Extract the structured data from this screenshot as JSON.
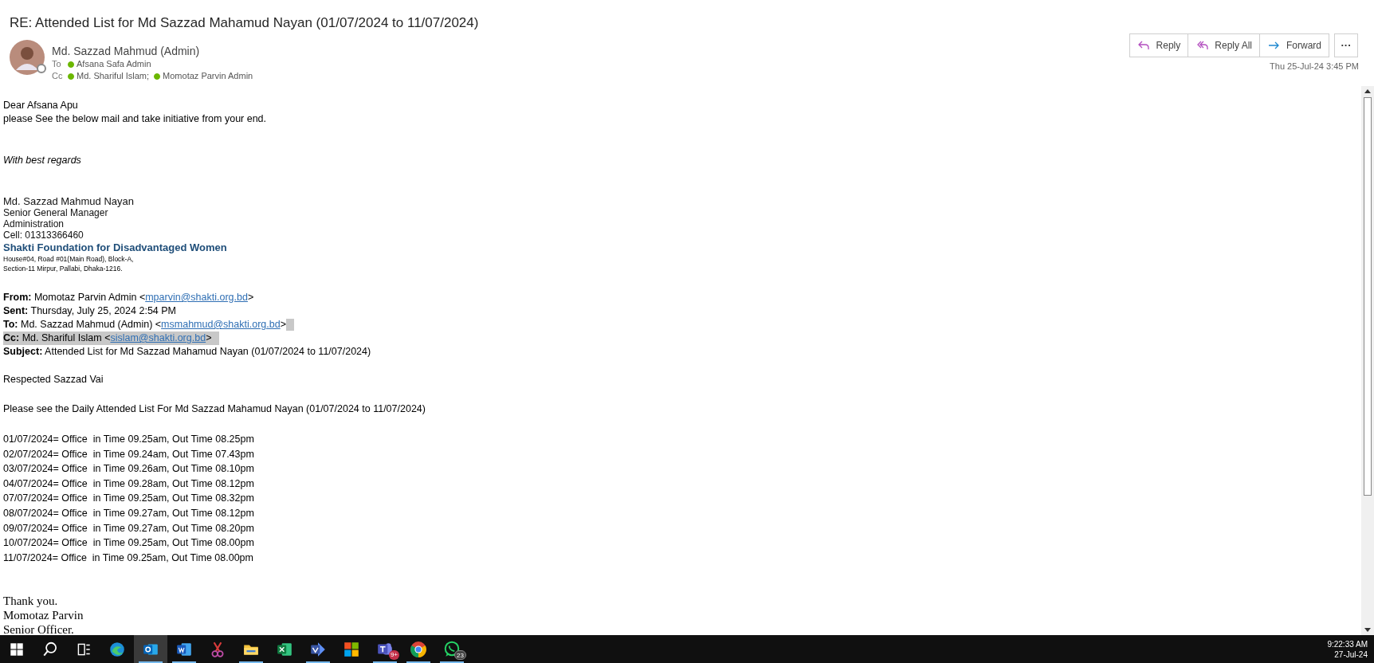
{
  "message": {
    "subject": "RE: Attended List for Md Sazzad Mahamud Nayan (01/07/2024 to 11/07/2024)",
    "sender": {
      "name": "Md. Sazzad Mahmud (Admin)",
      "available": false
    },
    "to_label": "To",
    "to": [
      {
        "name": "Afsana Safa Admin",
        "available": true
      }
    ],
    "cc_label": "Cc",
    "cc": [
      {
        "name": "Md. Shariful Islam;",
        "available": true
      },
      {
        "name": "Momotaz Parvin Admin",
        "available": true
      }
    ],
    "actions": [
      {
        "kind": "reply",
        "label": "Reply"
      },
      {
        "kind": "reply_all",
        "label": "Reply All"
      },
      {
        "kind": "forward",
        "label": "Forward"
      },
      {
        "kind": "more",
        "label": "···"
      }
    ],
    "date": "Thu 25-Jul-24 3:45 PM"
  },
  "body": {
    "greeting": [
      "Dear Afsana Apu",
      "please See the below mail and take initiative from your end."
    ],
    "closing": "With best regards",
    "signature": {
      "name": "Md. Sazzad Mahmud Nayan",
      "lines": [
        "Senior General Manager",
        "Administration",
        "Cell: 01313366460"
      ],
      "organization": "Shakti Foundation for Disadvantaged Women",
      "address": [
        "House#04, Road #01(Main Road), Block-A,",
        "Section-11 Mirpur, Pallabi, Dhaka-1216."
      ]
    },
    "forwarded": [
      {
        "label": "From:",
        "text": " Momotaz Parvin Admin <",
        "email": "mparvin@shakti.org.bd",
        "after": ">",
        "highlighted": false,
        "trailing_highlight": false
      },
      {
        "label": "Sent:",
        "text": " Thursday, July 25, 2024 2:54 PM",
        "highlighted": false,
        "trailing_highlight": false
      },
      {
        "label": "To:",
        "text": " Md. Sazzad Mahmud (Admin) <",
        "email": "msmahmud@shakti.org.bd",
        "after": ">",
        "highlighted": false,
        "trailing_highlight": true
      },
      {
        "label": "Cc:",
        "text": " Md. Shariful Islam <",
        "email": "sislam@shakti.org.bd",
        "after": ">",
        "highlighted": true,
        "trailing_highlight": false
      },
      {
        "label": "Subject:",
        "text": " Attended List for Md Sazzad Mahamud Nayan (01/07/2024 to 11/07/2024)",
        "highlighted": false,
        "trailing_highlight": false
      }
    ],
    "salutation": "Respected Sazzad Vai",
    "intro": "Please see the Daily Attended List For Md Sazzad Mahamud Nayan (01/07/2024 to 11/07/2024)",
    "attendance": [
      "01/07/2024= Office  in Time 09.25am, Out Time 08.25pm",
      "02/07/2024= Office  in Time 09.24am, Out Time 07.43pm",
      "03/07/2024= Office  in Time 09.26am, Out Time 08.10pm",
      "04/07/2024= Office  in Time 09.28am, Out Time 08.12pm",
      "07/07/2024= Office  in Time 09.25am, Out Time 08.32pm",
      "08/07/2024= Office  in Time 09.27am, Out Time 08.12pm",
      "09/07/2024= Office  in Time 09.27am, Out Time 08.20pm",
      "10/07/2024= Office  in Time 09.25am, Out Time 08.00pm",
      "11/07/2024= Office  in Time 09.25am, Out Time 08.00pm"
    ],
    "thanks": [
      "Thank you.",
      "Momotaz Parvin",
      "Senior Officer."
    ]
  },
  "taskbar": {
    "items": [
      {
        "kind": "start",
        "running": false,
        "selected": false
      },
      {
        "kind": "search",
        "running": false,
        "selected": false
      },
      {
        "kind": "taskview",
        "running": false,
        "selected": false
      },
      {
        "kind": "edge",
        "running": false,
        "selected": false
      },
      {
        "kind": "outlook",
        "running": true,
        "selected": true
      },
      {
        "kind": "word",
        "running": true,
        "selected": false
      },
      {
        "kind": "snip",
        "running": false,
        "selected": false
      },
      {
        "kind": "explorer",
        "running": true,
        "selected": false
      },
      {
        "kind": "excel",
        "running": false,
        "selected": false
      },
      {
        "kind": "visio",
        "running": true,
        "selected": false
      },
      {
        "kind": "store",
        "running": false,
        "selected": false
      },
      {
        "kind": "teams",
        "running": true,
        "selected": false,
        "badge": "9+"
      },
      {
        "kind": "chrome",
        "running": true,
        "selected": false
      },
      {
        "kind": "whatsapp",
        "running": true,
        "selected": false,
        "badge": "23"
      }
    ],
    "time": "9:22:33 AM",
    "date": "27-Jul-24"
  }
}
